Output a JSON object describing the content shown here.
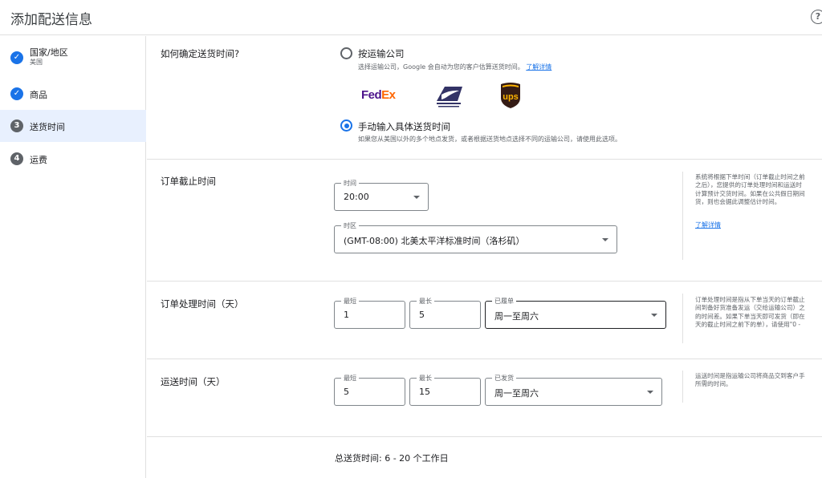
{
  "header": {
    "title": "添加配送信息",
    "help_icon": "?"
  },
  "sidebar": {
    "steps": [
      {
        "label": "国家/地区",
        "sub": "美国",
        "status": "done",
        "icon": "check-icon"
      },
      {
        "label": "商品",
        "status": "done",
        "icon": "check-icon"
      },
      {
        "label": "送货时间",
        "number": "3",
        "status": "active"
      },
      {
        "label": "运费",
        "number": "4",
        "status": "pending"
      }
    ]
  },
  "delivery_method": {
    "label": "如何确定送货时间?",
    "options": [
      {
        "title": "按运输公司",
        "desc": "选择运输公司，Google 会自动为您的客户估算送货时间。",
        "link": "了解详情",
        "checked": false
      },
      {
        "title": "手动输入具体送货时间",
        "desc": "如果您从美国以外的多个地点发货，或者根据送货地点选择不同的运输公司，请使用此选项。",
        "checked": true
      }
    ],
    "carriers": [
      {
        "name": "FedEx",
        "part1": "Fed",
        "part2": "Ex",
        "colors": [
          "#4d148c",
          "#ff6600"
        ]
      },
      {
        "name": "USPS",
        "icon": "usps-eagle-icon",
        "color": "#333366"
      },
      {
        "name": "UPS",
        "text": "ups",
        "colors": [
          "#351c15",
          "#ffb500"
        ]
      }
    ]
  },
  "cutoff": {
    "label": "订单截止时间",
    "time": {
      "label": "时间",
      "value": "20:00"
    },
    "timezone": {
      "label": "时区",
      "value": "(GMT-08:00) 北美太平洋标准时间（洛杉矶）"
    },
    "help": "系统将根据下单时间（订单截止时间之前\n之后），您提供的订单处理时间和运送时\n计算预计交货时间。如果在公共假日期间\n货，则也会据此调整估计时间。",
    "help_link": "了解详情"
  },
  "handling": {
    "label": "订单处理时间（天）",
    "min": {
      "label": "最短",
      "value": "1"
    },
    "max": {
      "label": "最长",
      "value": "5"
    },
    "days": {
      "label": "已履单",
      "value": "周一至周六"
    },
    "help": "订单处理时间是指从下单当天的订单截止\n间到备好货准备发运（交给运输公司）之\n的时间差。如果下单当天即可发货（即在\n天的截止时间之前下的单），请使用\"0 -"
  },
  "transit": {
    "label": "运送时间（天）",
    "min": {
      "label": "最短",
      "value": "5"
    },
    "max": {
      "label": "最长",
      "value": "15"
    },
    "days": {
      "label": "已发货",
      "value": "周一至周六"
    },
    "help": "运送时间是指运输公司将商品交到客户手\n所需的时间。"
  },
  "total": {
    "text": "总送货时间: 6 - 20 个工作日"
  }
}
